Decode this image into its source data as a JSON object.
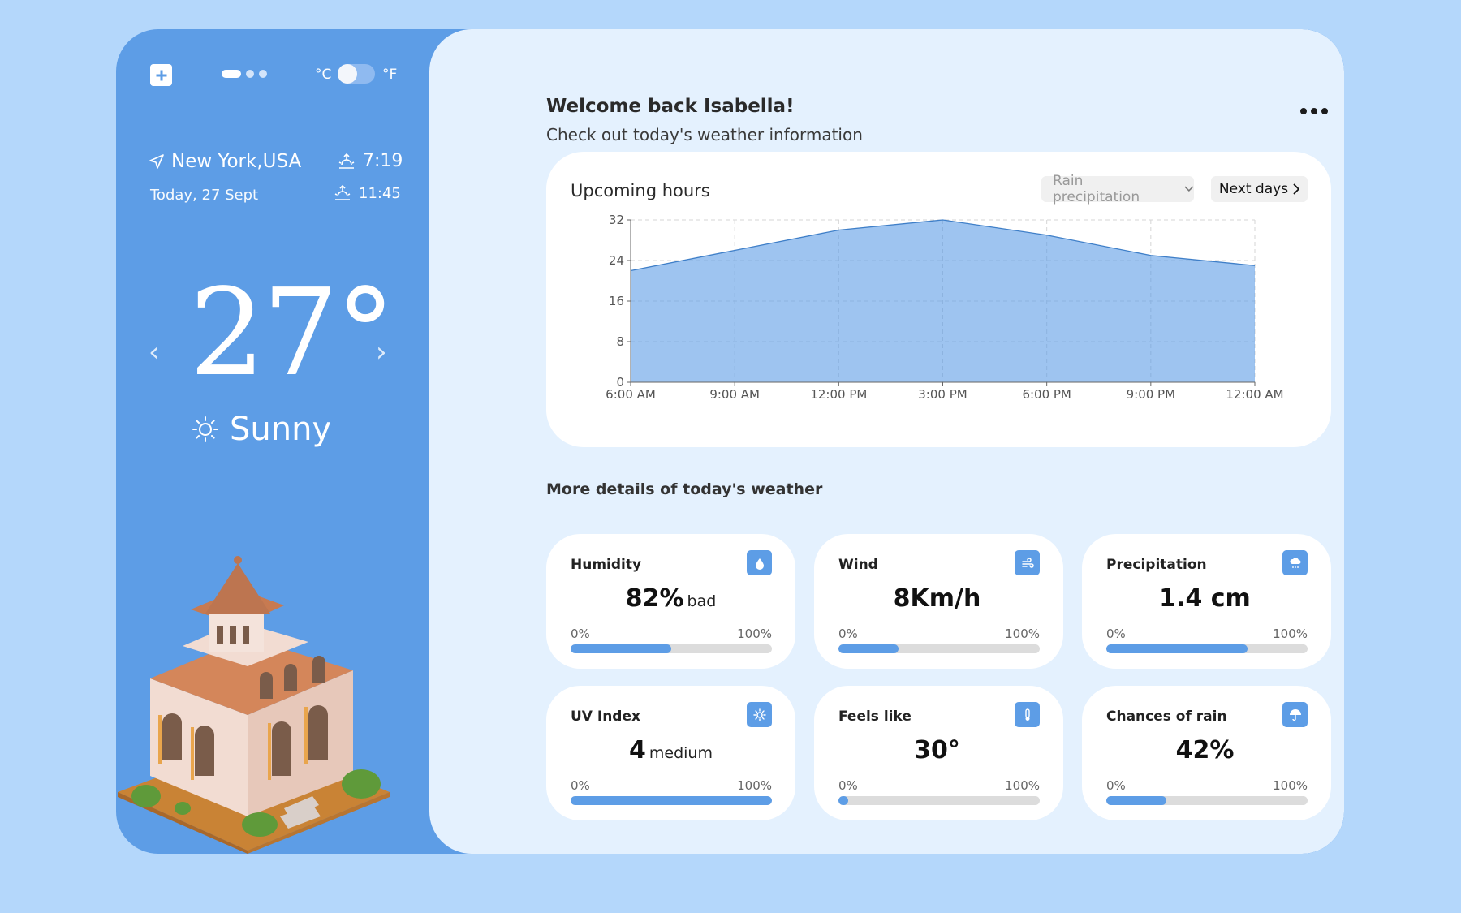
{
  "sidebar": {
    "unit_c": "°C",
    "unit_f": "°F",
    "location": "New York,USA",
    "date": "Today, 27 Sept",
    "sunrise": "7:19",
    "sunset": "11:45",
    "temperature": "27°",
    "condition": "Sunny"
  },
  "header": {
    "greeting": "Welcome back Isabella!",
    "subtitle": "Check out today's weather information"
  },
  "chart": {
    "title": "Upcoming hours",
    "select_value": "Rain precipitation",
    "next_label": "Next days"
  },
  "chart_data": {
    "type": "area",
    "categories": [
      "6:00 AM",
      "9:00 AM",
      "12:00 PM",
      "3:00 PM",
      "6:00 PM",
      "9:00 PM",
      "12:00 AM"
    ],
    "values": [
      22,
      26,
      30,
      32,
      29,
      25,
      23
    ],
    "yticks": [
      0,
      8,
      16,
      24,
      32
    ],
    "ylim": [
      0,
      32
    ],
    "grid": true,
    "color": "#5d9de6"
  },
  "details": {
    "title": "More details of today's weather",
    "cards": [
      {
        "title": "Humidity",
        "value": "82%",
        "suffix": "bad",
        "min": "0%",
        "max": "100%",
        "level": 0.5,
        "icon": "droplet-icon"
      },
      {
        "title": "Wind",
        "value": "8Km/h",
        "suffix": "",
        "min": "0%",
        "max": "100%",
        "level": 0.3,
        "icon": "wind-icon"
      },
      {
        "title": "Precipitation",
        "value": "1.4 cm",
        "suffix": "",
        "min": "0%",
        "max": "100%",
        "level": 0.7,
        "icon": "cloud-rain-icon"
      },
      {
        "title": "UV Index",
        "value": "4",
        "suffix": "medium",
        "min": "0%",
        "max": "100%",
        "level": 1.0,
        "icon": "sun-icon"
      },
      {
        "title": "Feels like",
        "value": "30°",
        "suffix": "",
        "min": "0%",
        "max": "100%",
        "level": 0.05,
        "icon": "thermometer-icon"
      },
      {
        "title": "Chances of rain",
        "value": "42%",
        "suffix": "",
        "min": "0%",
        "max": "100%",
        "level": 0.3,
        "icon": "umbrella-icon"
      }
    ]
  },
  "colors": {
    "accent": "#5d9de6",
    "background": "#b4d7fb",
    "panel": "#e4f1fe"
  }
}
